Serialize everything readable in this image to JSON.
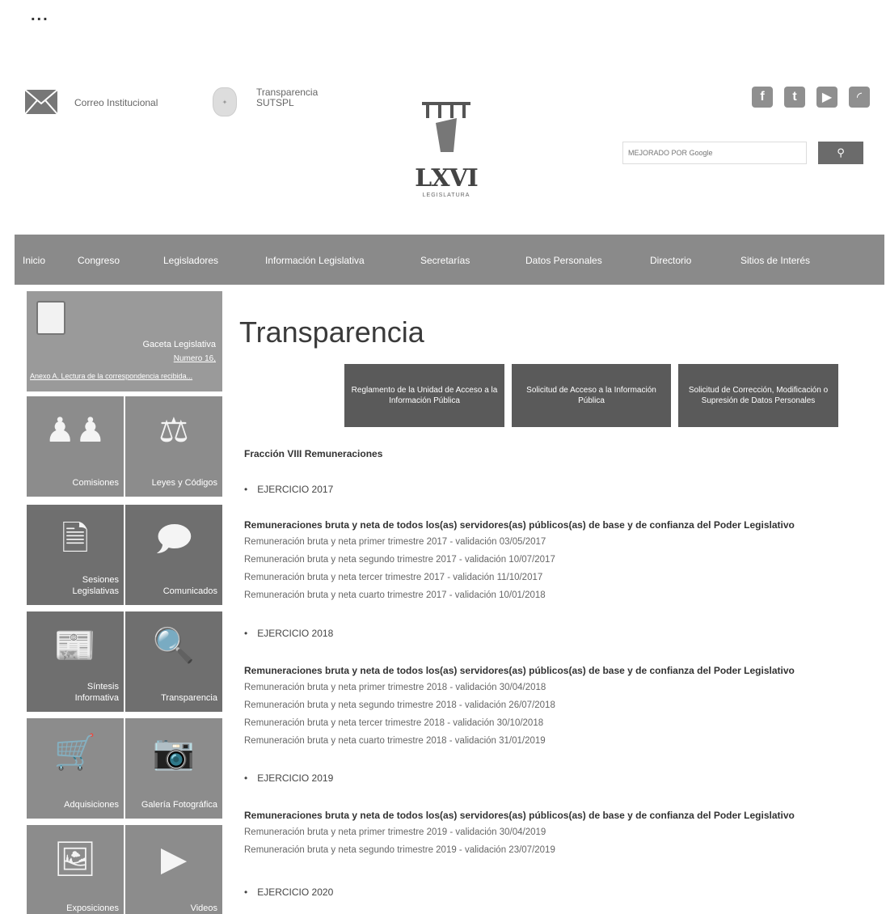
{
  "overflow_menu": "...",
  "header": {
    "mail_label": "Correo Institucional",
    "transparencia_line1": "Transparencia",
    "transparencia_line2": "SUTSPL",
    "logo_main": "LXVI",
    "logo_sub": "LEGISLATURA",
    "search_placeholder": "MEJORADO POR Google",
    "social": [
      "facebook-icon",
      "twitter-icon",
      "youtube-icon",
      "rss-icon"
    ]
  },
  "nav": [
    "Inicio",
    "Congreso",
    "Legisladores",
    "Información Legislativa",
    "Secretarías",
    "Datos Personales",
    "Directorio",
    "Sitios de Interés"
  ],
  "sidebar": {
    "gaceta_title": "Gaceta Legislativa",
    "gaceta_number": "Numero 16,",
    "gaceta_link": "Anexo A. Lectura de la correspondencia recibida...",
    "tiles": [
      {
        "label": "Comisiones",
        "icon": "people-icon"
      },
      {
        "label": "Leyes y Códigos",
        "icon": "scales-icon"
      },
      {
        "label": "Sesiones Legislativas",
        "icon": "documents-icon"
      },
      {
        "label": "Comunicados",
        "icon": "speech-icon"
      },
      {
        "label": "Síntesis Informativa",
        "icon": "newspaper-icon"
      },
      {
        "label": "Transparencia",
        "icon": "magnifier-doc-icon"
      },
      {
        "label": "Adquisiciones",
        "icon": "cart-icon"
      },
      {
        "label": "Galería Fotográfica",
        "icon": "camera-icon"
      },
      {
        "label": "Exposiciones",
        "icon": "easel-icon"
      },
      {
        "label": "Videos",
        "icon": "play-icon"
      }
    ]
  },
  "main": {
    "title": "Transparencia",
    "buttons": [
      "Reglamento de la Unidad de Acceso a la Información Pública",
      "Solicitud de Acceso a la Información Pública",
      "Solicitud de Corrección, Modificación o Supresión de Datos Personales"
    ],
    "section": "Fracción VIII Remuneraciones",
    "years": [
      {
        "label": "EJERCICIO 2017",
        "heading": "Remuneraciones bruta y neta de todos los(as) servidores(as) públicos(as) de base y de confianza del Poder Legislativo",
        "items": [
          "Remuneración bruta y neta primer trimestre 2017 - validación 03/05/2017",
          "Remuneración bruta y neta segundo trimestre 2017 - validación 10/07/2017",
          "Remuneración bruta y neta tercer trimestre 2017 - validación 11/10/2017",
          "Remuneración bruta y neta cuarto trimestre 2017 - validación 10/01/2018"
        ]
      },
      {
        "label": "EJERCICIO 2018",
        "heading": "Remuneraciones bruta y neta de todos los(as) servidores(as) públicos(as) de base y de confianza del Poder Legislativo",
        "items": [
          "Remuneración bruta y neta primer trimestre 2018 - validación 30/04/2018",
          "Remuneración bruta y neta segundo trimestre 2018 - validación 26/07/2018",
          "Remuneración bruta y neta tercer trimestre 2018 - validación 30/10/2018",
          "Remuneración bruta y neta cuarto trimestre 2018 - validación 31/01/2019"
        ]
      },
      {
        "label": "EJERCICIO 2019",
        "heading": "Remuneraciones bruta y neta de todos los(as) servidores(as) públicos(as) de base y de confianza del Poder Legislativo",
        "items": [
          "Remuneración bruta y neta primer trimestre 2019 - validación 30/04/2019",
          "Remuneración bruta y neta segundo trimestre 2019 - validación 23/07/2019"
        ]
      },
      {
        "label": "EJERCICIO 2020",
        "heading": "",
        "items": []
      }
    ]
  }
}
